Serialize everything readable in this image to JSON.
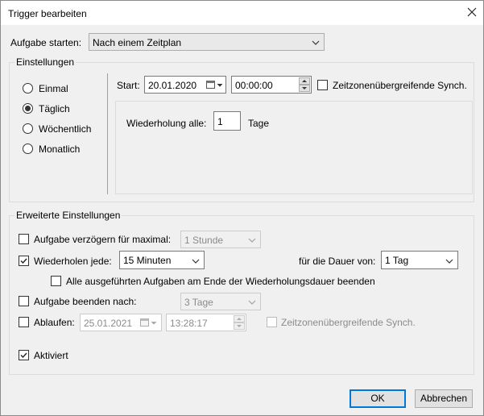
{
  "window": {
    "title": "Trigger bearbeiten"
  },
  "top": {
    "start_label": "Aufgabe starten:",
    "start_value": "Nach einem Zeitplan"
  },
  "settings": {
    "legend": "Einstellungen",
    "radios": [
      {
        "label": "Einmal",
        "selected": false
      },
      {
        "label": "Täglich",
        "selected": true
      },
      {
        "label": "Wöchentlich",
        "selected": false
      },
      {
        "label": "Monatlich",
        "selected": false
      }
    ],
    "start_label": "Start:",
    "start_date": "20.01.2020",
    "start_time": "00:00:00",
    "sync_label": "Zeitzonenübergreifende Synch.",
    "sync_checked": false,
    "repeat_label": "Wiederholung alle:",
    "repeat_value": "1",
    "repeat_unit": "Tage"
  },
  "advanced": {
    "legend": "Erweiterte Einstellungen",
    "delay_label": "Aufgabe verzögern für maximal:",
    "delay_checked": false,
    "delay_value": "1 Stunde",
    "repeat_label": "Wiederholen jede:",
    "repeat_checked": true,
    "repeat_value": "15 Minuten",
    "duration_label": "für die Dauer von:",
    "duration_value": "1 Tag",
    "stop_all_label": "Alle ausgeführten Aufgaben am Ende der Wiederholungsdauer beenden",
    "stop_all_checked": false,
    "stop_after_label": "Aufgabe beenden nach:",
    "stop_after_checked": false,
    "stop_after_value": "3 Tage",
    "expire_label": "Ablaufen:",
    "expire_checked": false,
    "expire_date": "25.01.2021",
    "expire_time": "13:28:17",
    "expire_sync_label": "Zeitzonenübergreifende Synch.",
    "enabled_label": "Aktiviert",
    "enabled_checked": true
  },
  "buttons": {
    "ok": "OK",
    "cancel": "Abbrechen"
  },
  "icons": {
    "close": "close-icon",
    "dropdown": "chevron-down-icon",
    "calendar": "calendar-icon",
    "spinner": "spinner-icon",
    "check": "checkmark-icon"
  }
}
